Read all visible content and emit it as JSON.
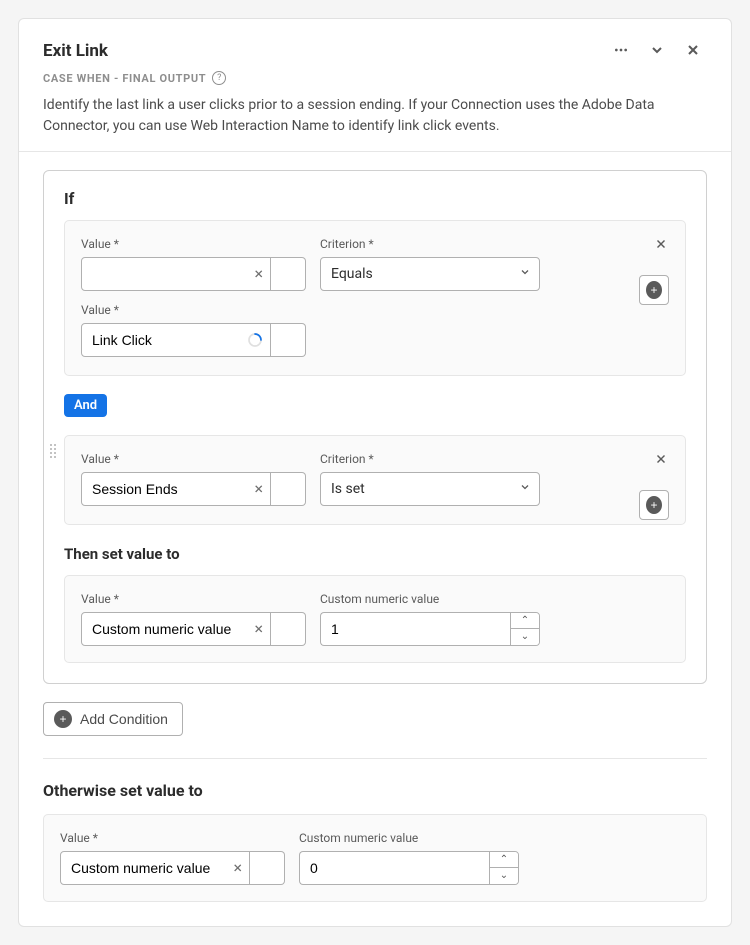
{
  "header": {
    "title": "Exit Link",
    "subtitle": "CASE WHEN - FINAL OUTPUT",
    "description": "Identify the last link a user clicks prior to a session ending. If your Connection uses the Adobe Data Connector, you can use Web Interaction Name to identify link click events."
  },
  "labels": {
    "value": "Value",
    "criterion": "Criterion",
    "custom_numeric": "Custom numeric value"
  },
  "if": {
    "title": "If",
    "cond1": {
      "value1": "",
      "criterion": "Equals",
      "value2": "Link Click"
    },
    "operator": "And",
    "cond2": {
      "value1": "Session Ends",
      "criterion": "Is set"
    },
    "then_title": "Then set value to",
    "then": {
      "value": "Custom numeric value",
      "numeric": "1"
    },
    "add_condition": "Add Condition"
  },
  "otherwise": {
    "title": "Otherwise set value to",
    "value": "Custom numeric value",
    "numeric": "0"
  }
}
